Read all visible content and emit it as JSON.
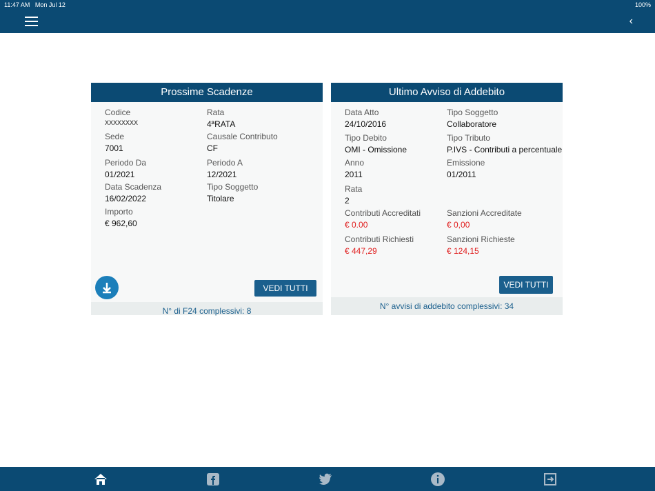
{
  "status": {
    "time": "11:47 AM",
    "date": "Mon Jul 12",
    "battery": "100%"
  },
  "card1": {
    "title": "Prossime Scadenze",
    "labels": {
      "codice": "Codice",
      "rata": "Rata",
      "sede": "Sede",
      "causale": "Causale Contributo",
      "da": "Periodo Da",
      "a": "Periodo A",
      "scadenza": "Data Scadenza",
      "tipo": "Tipo Soggetto",
      "importo": "Importo"
    },
    "values": {
      "codice": "XXXXXXXX",
      "rata": "4ªRATA",
      "sede": "7001",
      "causale": "CF",
      "da": "01/2021",
      "a": "12/2021",
      "scadenza": "16/02/2022",
      "tipo": "Titolare",
      "importo": "€ 962,60"
    },
    "button": "VEDI TUTTI",
    "footer": "N° di F24 complessivi: 8"
  },
  "card2": {
    "title": "Ultimo Avviso  di Addebito",
    "labels": {
      "data": "Data Atto",
      "tipo": "Tipo Soggetto",
      "debito": "Tipo Debito",
      "tributo": "Tipo Tributo",
      "anno": "Anno",
      "emissione": "Emissione",
      "rata": "Rata",
      "contr_acc": "Contributi Accreditati",
      "sanz_acc": "Sanzioni Accreditate",
      "contr_rich": "Contributi Richiesti",
      "sanz_rich": "Sanzioni Richieste"
    },
    "values": {
      "data": "24/10/2016",
      "tipo": "Collaboratore",
      "debito": "OMI - Omissione",
      "tributo": "P.IVS - Contributi a percentuale",
      "anno": "2011",
      "emissione": "01/2011",
      "rata": "2",
      "contr_acc": "€ 0.00",
      "sanz_acc": "€ 0,00",
      "contr_rich": "€ 447,29",
      "sanz_rich": "€ 124,15"
    },
    "button": "VEDI TUTTI",
    "footer": "N° avvisi di addebito complessivi: 34"
  },
  "colors": {
    "primary": "#0b4a73",
    "accent": "#1c7fba",
    "red": "#e01d1d"
  }
}
